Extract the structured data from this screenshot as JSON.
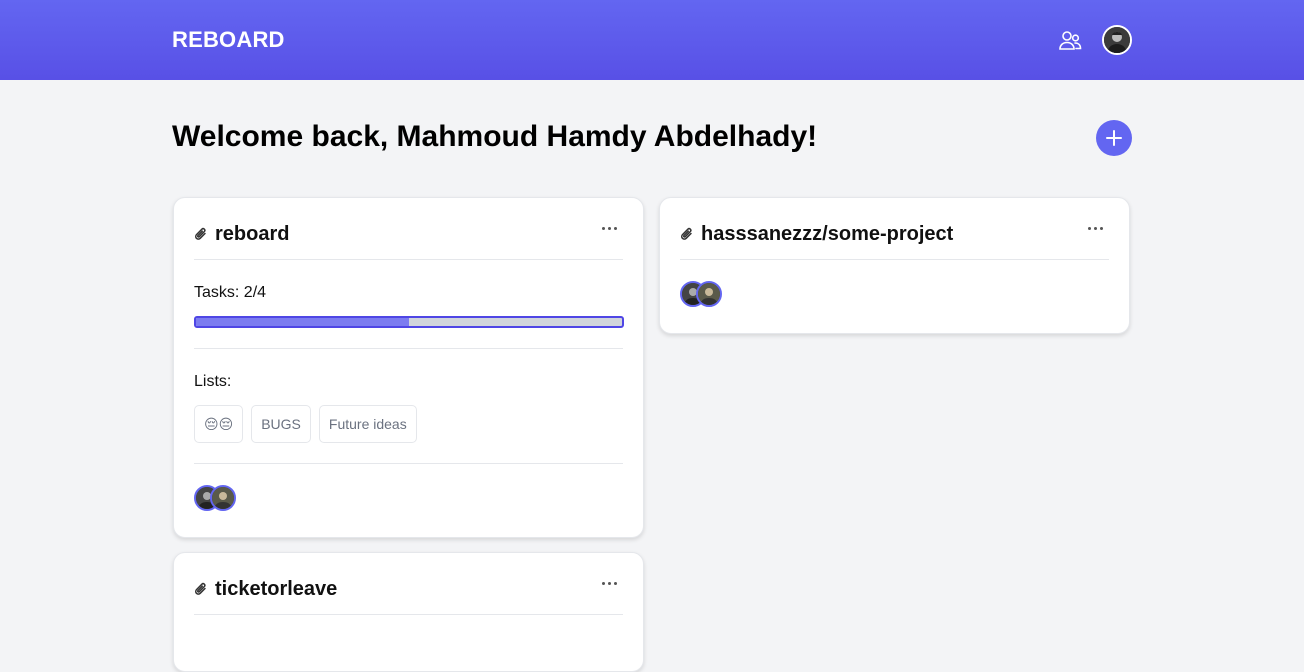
{
  "header": {
    "brand": "REBOARD",
    "users_icon": "users-icon",
    "avatar_icon": "user-avatar"
  },
  "main": {
    "welcome": "Welcome back, Mahmoud Hamdy Abdelhady!",
    "add_icon": "plus-icon"
  },
  "boards": [
    {
      "title": "reboard",
      "tasks_label": "Tasks: 2/4",
      "progress": 0.5,
      "lists_label": "Lists:",
      "lists": [
        "😔😔",
        "BUGS",
        "Future ideas"
      ],
      "members_count": 2
    },
    {
      "title": "hasssanezzz/some-project",
      "members_count": 2
    },
    {
      "title": "ticketorleave"
    }
  ],
  "colors": {
    "accent": "#6366f1",
    "progress_fill": "#7c7cf0",
    "progress_track": "#d1d5db",
    "page_bg": "#f3f4f6"
  }
}
